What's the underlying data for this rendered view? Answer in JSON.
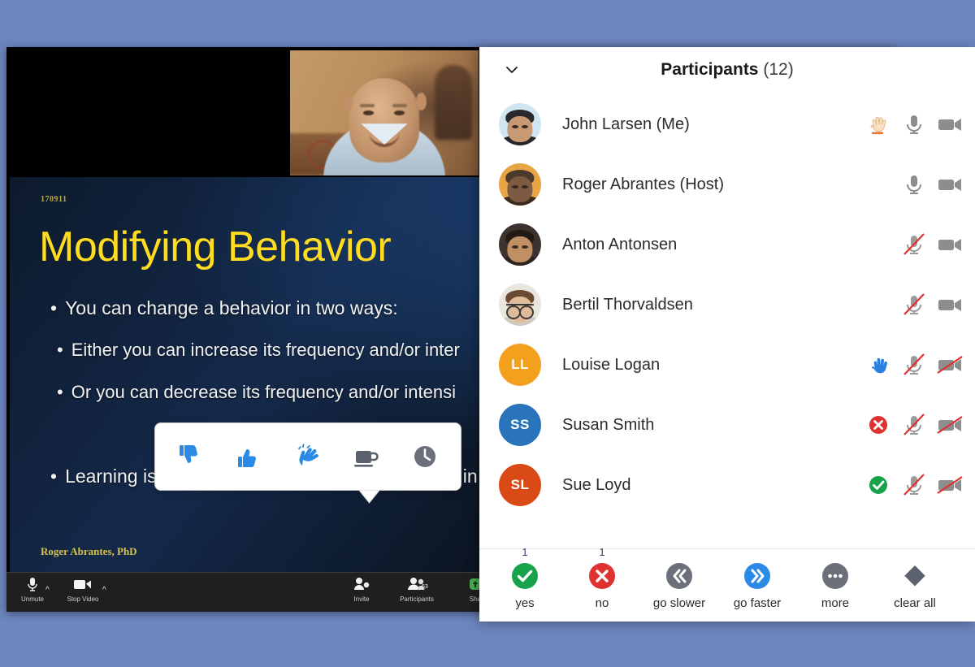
{
  "desktop": {
    "background_color": "#6d86c0"
  },
  "meeting": {
    "slide": {
      "date_code": "170911",
      "title": "Modifying Behavior",
      "bullets": [
        "You can change a behavior in two ways:",
        "Either you can increase its frequency and/or inter",
        "Or you can decrease its frequency and/or intensi",
        "Learning is therefore changing the frequency or in"
      ],
      "footer": "Roger Abrantes, PhD"
    },
    "toolbar": {
      "unmute_label": "Unmute",
      "unmute_icon": "microphone-icon",
      "video_label": "Stop Video",
      "video_icon": "camera-icon",
      "invite_label": "Invite",
      "invite_icon": "add-person-icon",
      "participants_label": "Participants",
      "participants_icon": "people-icon",
      "participants_badge": "63",
      "share_label": "Sha",
      "share_icon": "share-screen-icon",
      "caret_icon": "chevron-up-icon"
    }
  },
  "panel": {
    "collapse_icon": "chevron-down-icon",
    "title": "Participants",
    "count": "(12)",
    "participants": [
      {
        "name": "John Larsen (Me)",
        "avatar_type": "photo",
        "avatar_bg": "#cfe6f2",
        "hair": "#2a2a2e",
        "skin": "#c79a74",
        "shirt": "#26262b",
        "glasses": false,
        "status_icons": [
          "raised-hand-icon",
          "microphone-on-icon",
          "camera-on-icon"
        ]
      },
      {
        "name": "Roger Abrantes (Host)",
        "avatar_type": "photo",
        "avatar_bg": "#e8a545",
        "hair": "#4a3a2c",
        "skin": "#7d5a42",
        "shirt": "#3b2a20",
        "glasses": false,
        "status_icons": [
          "microphone-on-icon",
          "camera-on-icon"
        ]
      },
      {
        "name": "Anton Antonsen",
        "avatar_type": "photo",
        "avatar_bg": "#3c3330",
        "hair": "#241a14",
        "skin": "#c08f63",
        "shirt": "#2e2420",
        "glasses": false,
        "status_icons": [
          "microphone-muted-icon",
          "camera-on-icon"
        ]
      },
      {
        "name": "Bertil Thorvaldsen",
        "avatar_type": "photo",
        "avatar_bg": "#e9e6df",
        "hair": "#6a4a30",
        "skin": "#e0bb99",
        "shirt": "#cfc9bd",
        "glasses": true,
        "status_icons": [
          "microphone-muted-icon",
          "camera-on-icon"
        ]
      },
      {
        "name": "Louise  Logan",
        "avatar_type": "initials",
        "initials": "LL",
        "avatar_bg": "#f2a01e",
        "status_icons": [
          "raise-hand-blue-icon",
          "microphone-muted-icon",
          "camera-off-icon"
        ]
      },
      {
        "name": "Susan Smith",
        "avatar_type": "initials",
        "initials": "SS",
        "avatar_bg": "#2a74bb",
        "status_icons": [
          "no-red-icon",
          "microphone-muted-icon",
          "camera-off-icon"
        ]
      },
      {
        "name": "Sue Loyd",
        "avatar_type": "initials",
        "initials": "SL",
        "avatar_bg": "#d94a16",
        "status_icons": [
          "yes-green-icon",
          "microphone-muted-icon",
          "camera-off-icon"
        ]
      }
    ]
  },
  "actions": [
    {
      "label": "yes",
      "icon": "check-circle-icon",
      "count": "1",
      "color": "#16a34a"
    },
    {
      "label": "no",
      "icon": "x-circle-icon",
      "count": "1",
      "color": "#e03131"
    },
    {
      "label": "go slower",
      "icon": "double-chevron-left-icon",
      "count": "",
      "color": "#6b6f7a"
    },
    {
      "label": "go faster",
      "icon": "double-chevron-right-icon",
      "count": "",
      "color": "#2b8ae6"
    },
    {
      "label": "more",
      "icon": "ellipsis-circle-icon",
      "count": "",
      "color": "#6b6f7a"
    },
    {
      "label": "clear all",
      "icon": "diamond-icon",
      "count": "",
      "color": "#5c616e"
    }
  ],
  "emoji_popup": {
    "items": [
      {
        "icon": "thumbs-down-icon",
        "color": "#2b8ae6"
      },
      {
        "icon": "thumbs-up-icon",
        "color": "#2b8ae6"
      },
      {
        "icon": "clap-icon",
        "color": "#2b8ae6"
      },
      {
        "icon": "coffee-cup-icon",
        "color": "#5c616e"
      },
      {
        "icon": "clock-icon",
        "color": "#6b6f7a"
      }
    ]
  }
}
